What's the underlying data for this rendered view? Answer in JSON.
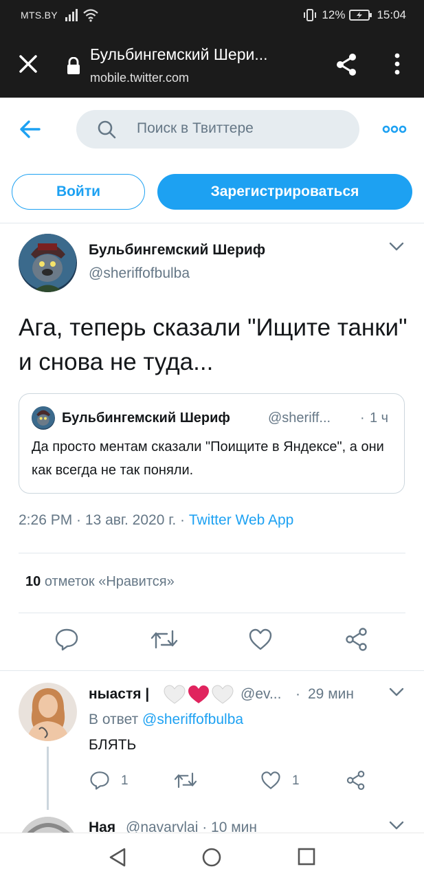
{
  "status_bar": {
    "carrier": "MTS.BY",
    "battery": "12%",
    "time": "15:04"
  },
  "browser": {
    "page_title": "Бульбингемский Шери...",
    "url": "mobile.twitter.com"
  },
  "header": {
    "search_placeholder": "Поиск в Твиттере"
  },
  "auth": {
    "login_label": "Войти",
    "signup_label": "Зарегистрироваться"
  },
  "tweet": {
    "author_name": "Бульбингемский Шериф",
    "author_handle": "@sheriffofbulba",
    "text": "Ага, теперь сказали \"Ищите танки\" и снова не туда...",
    "quote": {
      "author_name": "Бульбингемский Шериф",
      "author_handle": "@sheriff...",
      "separator": "·",
      "time": "1 ч",
      "text": "Да просто ментам сказали \"Поищите в Яндексе\", а они как всегда не так поняли."
    },
    "time": "2:26 PM",
    "date": "13 авг. 2020 г.",
    "app": "Twitter Web App",
    "meta_sep": " · ",
    "likes_count": "10",
    "likes_label": "отметок «Нравится»"
  },
  "reply": {
    "author_name": "ныастя |",
    "author_handle": "@ev...",
    "separator": "·",
    "time": "29 мин",
    "in_reply_prefix": "В ответ",
    "in_reply_mention": "@sheriffofbulba",
    "text": "БЛЯТЬ",
    "reply_count": "1",
    "like_count": "1"
  },
  "next_reply": {
    "author_name": "Ная",
    "author_handle": "@navarvlai · 10 мин"
  },
  "colors": {
    "accent": "#1da1f2",
    "secondary_text": "#657786",
    "bar_dark": "#1b1b1b",
    "heart_red": "#e0245e"
  }
}
